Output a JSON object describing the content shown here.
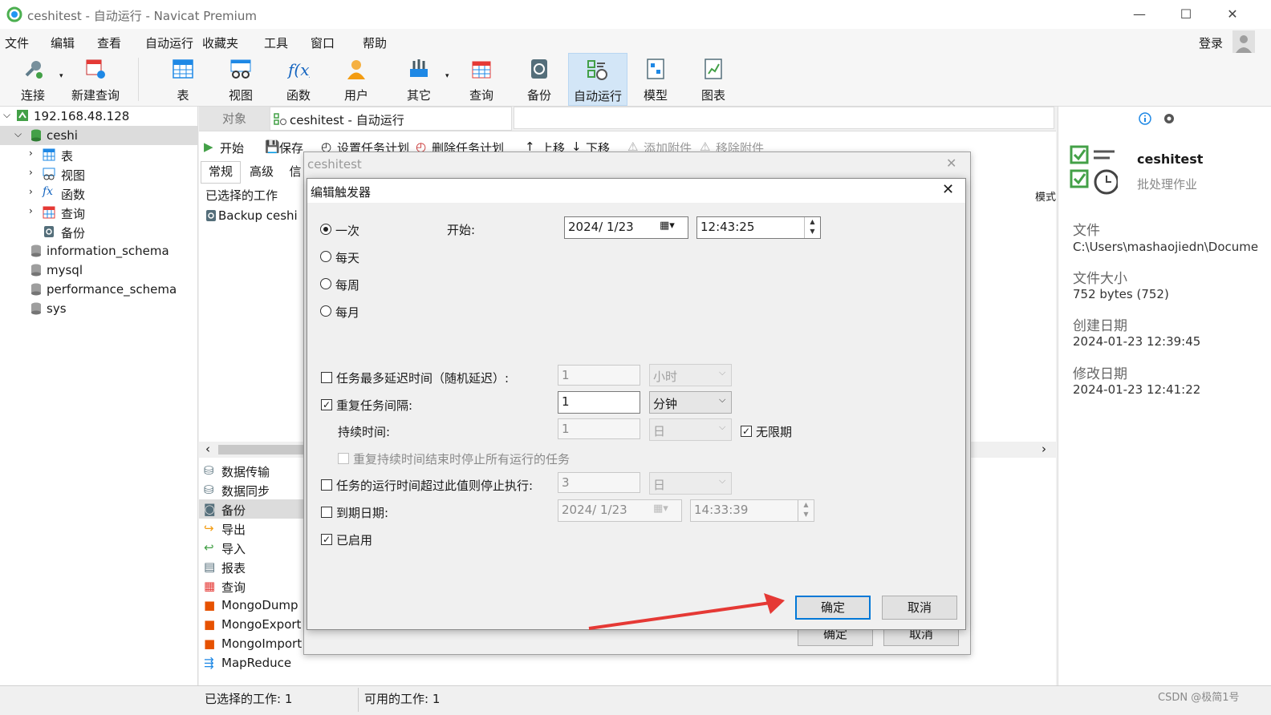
{
  "window": {
    "title": "ceshitest - 自动运行 - Navicat Premium",
    "login": "登录"
  },
  "menu": [
    "文件",
    "编辑",
    "查看",
    "自动运行",
    "收藏夹",
    "工具",
    "窗口",
    "帮助"
  ],
  "toolbar": [
    {
      "label": "连接",
      "icon": "plug-icon"
    },
    {
      "label": "新建查询",
      "icon": "new-query-icon"
    },
    {
      "label": "表",
      "icon": "table-icon"
    },
    {
      "label": "视图",
      "icon": "view-icon"
    },
    {
      "label": "函数",
      "icon": "function-icon"
    },
    {
      "label": "用户",
      "icon": "user-icon"
    },
    {
      "label": "其它",
      "icon": "tools-icon"
    },
    {
      "label": "查询",
      "icon": "query-icon"
    },
    {
      "label": "备份",
      "icon": "backup-icon"
    },
    {
      "label": "自动运行",
      "icon": "automation-icon"
    },
    {
      "label": "模型",
      "icon": "model-icon"
    },
    {
      "label": "图表",
      "icon": "chart-icon"
    }
  ],
  "tree": {
    "connection": "192.168.48.128",
    "database": "ceshi",
    "children": [
      "表",
      "视图",
      "函数",
      "查询",
      "备份"
    ],
    "schemas": [
      "information_schema",
      "mysql",
      "performance_schema",
      "sys"
    ]
  },
  "tabs": {
    "objects": "对象",
    "active": "ceshitest - 自动运行"
  },
  "task_toolbar": [
    "开始",
    "保存",
    "设置任务计划",
    "删除任务计划",
    "上移",
    "下移",
    "添加附件",
    "移除附件"
  ],
  "subtabs": [
    "常规",
    "高级",
    "信"
  ],
  "selected_jobs_header": "已选择的工作",
  "job_item": "Backup ceshi",
  "mode_header": "模式",
  "job_types": [
    "数据传输",
    "数据同步",
    "备份",
    "导出",
    "导入",
    "报表",
    "查询",
    "MongoDump",
    "MongoExport",
    "MongoImport",
    "MapReduce"
  ],
  "outer_dialog": {
    "title": "ceshitest",
    "ok": "确定",
    "cancel": "取消"
  },
  "dialog": {
    "title": "编辑触发器",
    "options": [
      "一次",
      "每天",
      "每周",
      "每月"
    ],
    "selected_option": "一次",
    "start_label": "开始:",
    "start_date": "2024/  1/23",
    "start_time": "12:43:25",
    "max_delay_label": "任务最多延迟时间（随机延迟）:",
    "max_delay_value": "1",
    "max_delay_unit": "小时",
    "repeat_label": "重复任务间隔:",
    "repeat_value": "1",
    "repeat_unit": "分钟",
    "duration_label": "持续时间:",
    "duration_value": "1",
    "duration_unit": "日",
    "infinite_label": "无限期",
    "stop_all_label": "重复持续时间结束时停止所有运行的任务",
    "stop_after_label": "任务的运行时间超过此值则停止执行:",
    "stop_after_value": "3",
    "stop_after_unit": "日",
    "expire_label": "到期日期:",
    "expire_date": "2024/  1/23",
    "expire_time": "14:33:39",
    "enabled_label": "已启用",
    "ok": "确定",
    "cancel": "取消",
    "checked": {
      "max_delay": false,
      "repeat": true,
      "infinite": true,
      "stop_all": false,
      "stop_after": false,
      "expire": false,
      "enabled": true
    }
  },
  "info_panel": {
    "name": "ceshitest",
    "type": "批处理作业",
    "file_label": "文件",
    "file_value": "C:\\Users\\mashaojiedn\\Docume",
    "size_label": "文件大小",
    "size_value": "752 bytes (752)",
    "created_label": "创建日期",
    "created_value": "2024-01-23 12:39:45",
    "modified_label": "修改日期",
    "modified_value": "2024-01-23 12:41:22"
  },
  "status": {
    "selected": "已选择的工作: 1",
    "available": "可用的工作: 1"
  },
  "watermark": "CSDN @极简1号",
  "colors": {
    "accent": "#0078d7",
    "arrow": "#e53935",
    "db_green": "#2e9e3e"
  }
}
